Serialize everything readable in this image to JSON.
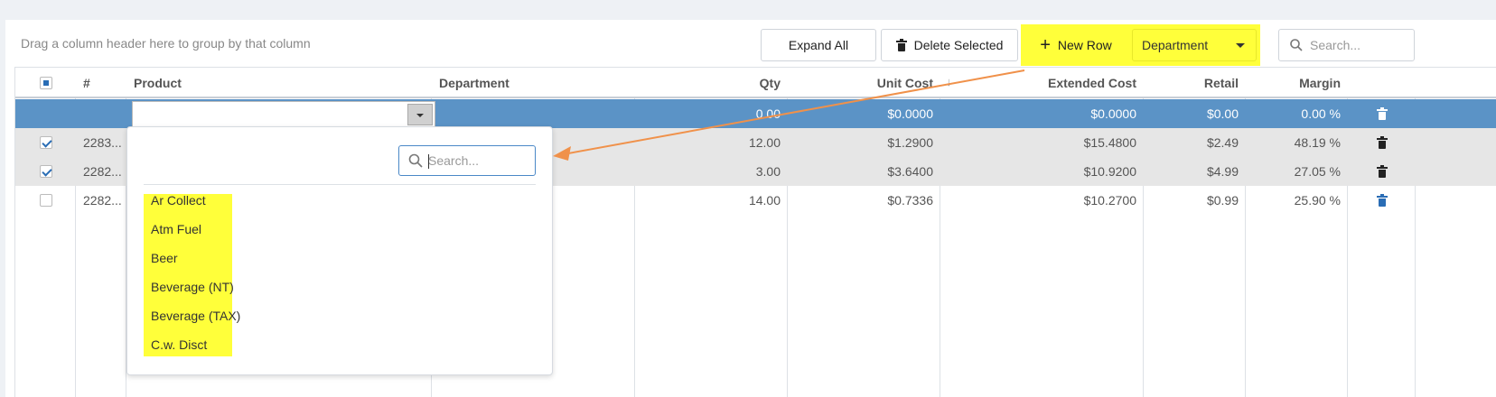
{
  "toolbar": {
    "group_hint": "Drag a column header here to group by that column",
    "expand_all": "Expand All",
    "delete_selected": "Delete Selected",
    "new_row": "New Row",
    "department_dropdown": "Department",
    "search_placeholder": "Search..."
  },
  "columns": {
    "num": "#",
    "product": "Product",
    "department": "Department",
    "qty": "Qty",
    "unit_cost": "Unit Cost",
    "extended_cost": "Extended Cost",
    "retail": "Retail",
    "margin": "Margin"
  },
  "new_row": {
    "qty": "0.00",
    "unit_cost": "$0.0000",
    "extended_cost": "$0.0000",
    "retail": "$0.00",
    "margin": "0.00 %"
  },
  "rows": [
    {
      "num": "2283...",
      "qty": "12.00",
      "unit_cost": "$1.2900",
      "extended_cost": "$15.4800",
      "retail": "$2.49",
      "margin": "48.19 %",
      "checked": true
    },
    {
      "num": "2282...",
      "qty": "3.00",
      "unit_cost": "$3.6400",
      "extended_cost": "$10.9200",
      "retail": "$4.99",
      "margin": "27.05 %",
      "checked": true
    },
    {
      "num": "2282...",
      "qty": "14.00",
      "unit_cost": "$0.7336",
      "extended_cost": "$10.2700",
      "retail": "$0.99",
      "margin": "25.90 %",
      "checked": false
    }
  ],
  "popup": {
    "search_placeholder": "Search...",
    "items": [
      "Ar Collect",
      "Atm Fuel",
      "Beer",
      "Beverage (NT)",
      "Beverage (TAX)",
      "C.w. Disct"
    ]
  },
  "colors": {
    "selected_row": "#5b93c6",
    "highlight": "#ffff3a",
    "arrow": "#f0914a",
    "trash_blue": "#2a6db5"
  },
  "icons": {
    "new_row": "plus-icon",
    "delete": "trash-icon",
    "search": "search-icon",
    "sort": "sort-down-icon"
  }
}
